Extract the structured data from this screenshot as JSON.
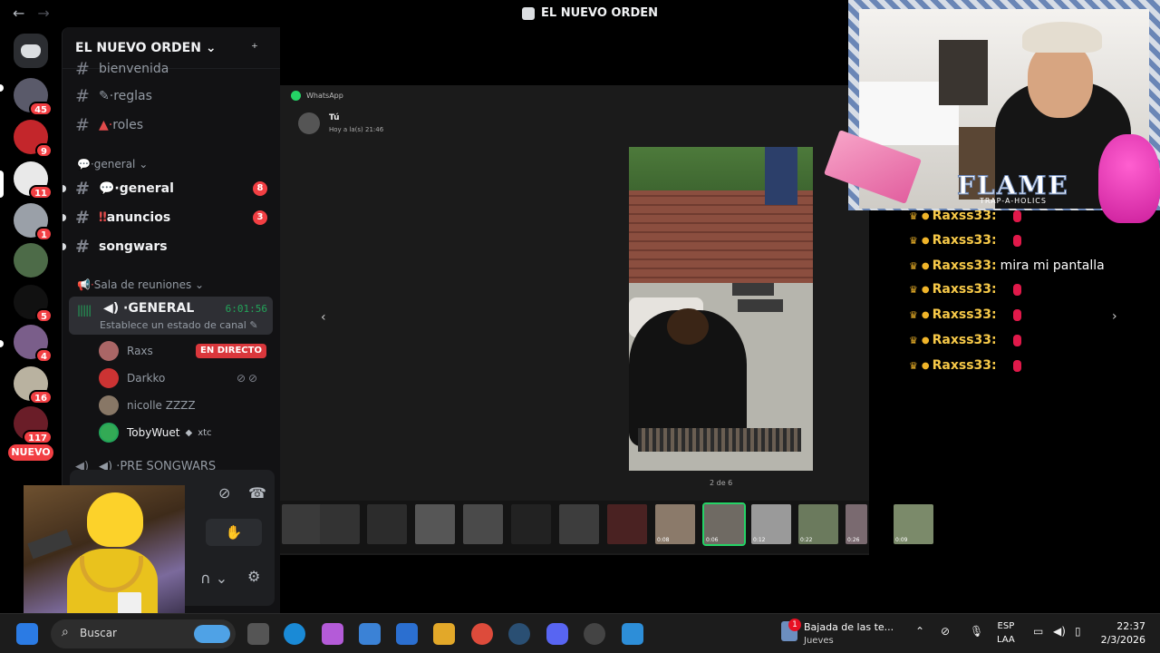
{
  "window": {
    "title": "EL NUEVO ORDEN",
    "back_icon": "arrow-left-icon",
    "forward_icon": "arrow-right-icon"
  },
  "servers": {
    "badges": [
      "45",
      "9",
      "11",
      "1",
      "5",
      "4",
      "16",
      "117"
    ],
    "new_label": "NUEVO"
  },
  "sidebar": {
    "guild_name": "EL NUEVO ORDEN",
    "channels_top": [
      {
        "name": "bienvenida"
      },
      {
        "name": "reglas"
      },
      {
        "name": "roles"
      }
    ],
    "category_general": "general",
    "channels_general": [
      {
        "name": "general",
        "count": "8"
      },
      {
        "name": "anuncios",
        "count": "3"
      },
      {
        "name": "songwars",
        "count": ""
      }
    ],
    "category_voice": "Sala de reuniones",
    "voice_channel": {
      "name": "GENERAL",
      "time": "6:01:56",
      "status": "Establece un estado de canal"
    },
    "voice_users": [
      {
        "name": "Raxs",
        "tag": "EN DIRECTO"
      },
      {
        "name": "Darkko",
        "tag": ""
      },
      {
        "name": "nicolle ZZZZ",
        "tag": ""
      },
      {
        "name": "TobyWuet",
        "tag": "xtc"
      }
    ],
    "next_channel": "PRE SONGWARS"
  },
  "viewer": {
    "app": "WhatsApp",
    "sender": "Tú",
    "sent_time": "Hoy a la(s) 21:46",
    "counter": "2 de 6",
    "thumbs": [
      {
        "dur": ""
      },
      {
        "dur": ""
      },
      {
        "dur": ""
      },
      {
        "dur": ""
      },
      {
        "dur": ""
      },
      {
        "dur": ""
      },
      {
        "dur": ""
      },
      {
        "dur": ""
      },
      {
        "dur": "0:08"
      },
      {
        "dur": "0:06"
      },
      {
        "dur": "0:12"
      },
      {
        "dur": "0:22"
      },
      {
        "dur": "0:26"
      },
      {
        "dur": "0:09"
      }
    ]
  },
  "chat": {
    "lines": [
      {
        "user": "Raxss33:",
        "msg": ""
      },
      {
        "user": "Raxss33:",
        "msg": ""
      },
      {
        "user": "Raxss33:",
        "msg": "mira mi pantalla"
      },
      {
        "user": "Raxss33:",
        "msg": ""
      },
      {
        "user": "Raxss33:",
        "msg": ""
      },
      {
        "user": "Raxss33:",
        "msg": ""
      },
      {
        "user": "Raxss33:",
        "msg": ""
      }
    ]
  },
  "overlay": {
    "brand": "FLAME",
    "sub": "TRAP-A-HOLICS"
  },
  "taskbar": {
    "search": "Buscar",
    "news_title": "Bajada de las te...",
    "news_sub": "Jueves",
    "news_badge": "1",
    "lang1": "ESP",
    "lang2": "LAA",
    "time": "22:37",
    "date": "2/3/2026"
  }
}
